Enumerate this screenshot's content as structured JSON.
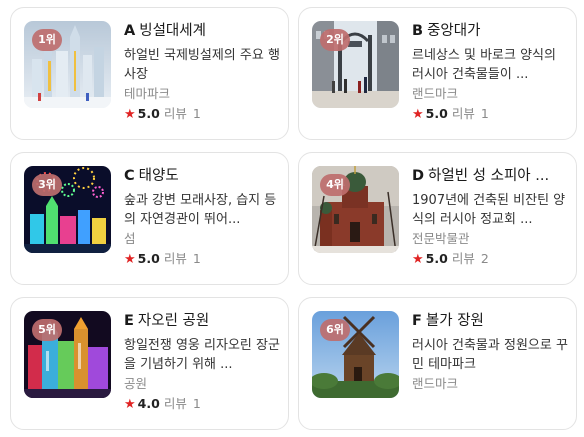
{
  "places": [
    {
      "rank": "1위",
      "letter": "A",
      "name": "빙설대세계",
      "desc": "하얼빈 국제빙설제의 주요 행사장",
      "category": "테마파크",
      "rating": "5.0",
      "review_label": "리뷰",
      "review_count": "1",
      "image": "ice-castle-photo"
    },
    {
      "rank": "2위",
      "letter": "B",
      "name": "중앙대가",
      "desc": "르네상스 및 바로크 양식의 러시아 건축물들이 ...",
      "category": "랜드마크",
      "rating": "5.0",
      "review_label": "리뷰",
      "review_count": "1",
      "image": "street-gate-photo"
    },
    {
      "rank": "3위",
      "letter": "C",
      "name": "태양도",
      "desc": "숲과 강변 모래사장, 습지 등의 자연경관이 뛰어...",
      "category": "섬",
      "rating": "5.0",
      "review_label": "리뷰",
      "review_count": "1",
      "image": "fireworks-ice-photo"
    },
    {
      "rank": "4위",
      "letter": "D",
      "name": "하얼빈 성 소피아 ...",
      "desc": "1907년에 건축된 비잔틴 양식의 러시아 정교회 ...",
      "category": "전문박물관",
      "rating": "5.0",
      "review_label": "리뷰",
      "review_count": "2",
      "image": "sofia-church-photo"
    },
    {
      "rank": "5위",
      "letter": "E",
      "name": "자오린 공원",
      "desc": "항일전쟁 영웅 리자오린 장군을 기념하기 위해 ...",
      "category": "공원",
      "rating": "4.0",
      "review_label": "리뷰",
      "review_count": "1",
      "image": "ice-lantern-photo"
    },
    {
      "rank": "6위",
      "letter": "F",
      "name": "볼가 장원",
      "desc": "러시아 건축물과 정원으로 꾸민 테마파크",
      "category": "랜드마크",
      "rating": "",
      "review_label": "",
      "review_count": "",
      "image": "windmill-photo"
    }
  ],
  "star_glyph": "★"
}
